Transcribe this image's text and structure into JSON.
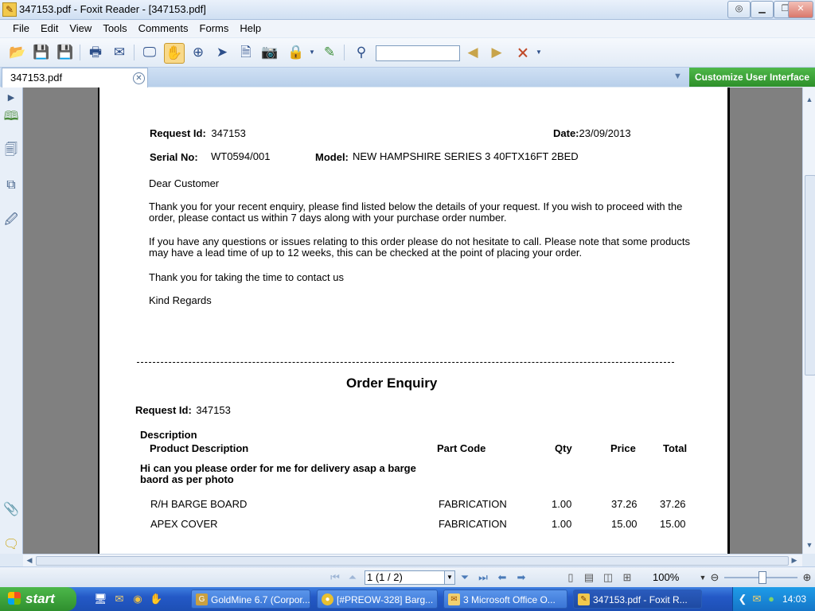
{
  "window": {
    "title": "347153.pdf - Foxit Reader - [347153.pdf]"
  },
  "menu": [
    "File",
    "Edit",
    "View",
    "Tools",
    "Comments",
    "Forms",
    "Help"
  ],
  "tab": {
    "label": "347153.pdf"
  },
  "customize_label": "Customize User Interface",
  "letter": {
    "request_id_label": "Request Id:",
    "request_id": "347153",
    "date_label": "Date:",
    "date": "23/09/2013",
    "serial_label": "Serial No:",
    "serial": "WT0594/001",
    "model_label": "Model:",
    "model": "NEW HAMPSHIRE SERIES 3 40FTX16FT 2BED",
    "greeting": "Dear Customer",
    "para1": "Thank you for your recent enquiry, please find listed below the details of your request. If you wish to proceed with the order, please contact us within 7 days along with your purchase order number.",
    "para2": "If you have any questions or issues relating to this order please do not hesitate to call. Please note that some products may have a lead time of up to 12 weeks, this can be checked at the point of placing your order.",
    "thanks": "Thank you for taking the time to contact us",
    "signoff": "Kind Regards"
  },
  "order": {
    "title": "Order Enquiry",
    "request_id_label": "Request Id:",
    "request_id": "347153",
    "description_label": "Description",
    "headers": {
      "product": "Product Description",
      "part": "Part Code",
      "qty": "Qty",
      "price": "Price",
      "total": "Total"
    },
    "note": "Hi can you please order for me for delivery asap a barge baord as per photo",
    "rows": [
      {
        "product": "R/H BARGE BOARD",
        "part": "FABRICATION",
        "qty": "1.00",
        "price": "37.26",
        "total": "37.26"
      },
      {
        "product": "APEX COVER",
        "part": "FABRICATION",
        "qty": "1.00",
        "price": "15.00",
        "total": "15.00"
      }
    ]
  },
  "status": {
    "page": "1 (1 / 2)",
    "zoom": "100%"
  },
  "taskbar": {
    "start": "start",
    "tasks": [
      "GoldMine 6.7 (Corpor...",
      "[#PREOW-328] Barg...",
      "3 Microsoft Office O...",
      "347153.pdf - Foxit R..."
    ],
    "clock": "14:03"
  },
  "colors": {
    "accent": "#2d8f2a",
    "taskbar": "#2459c7",
    "page_gray": "#808080"
  }
}
